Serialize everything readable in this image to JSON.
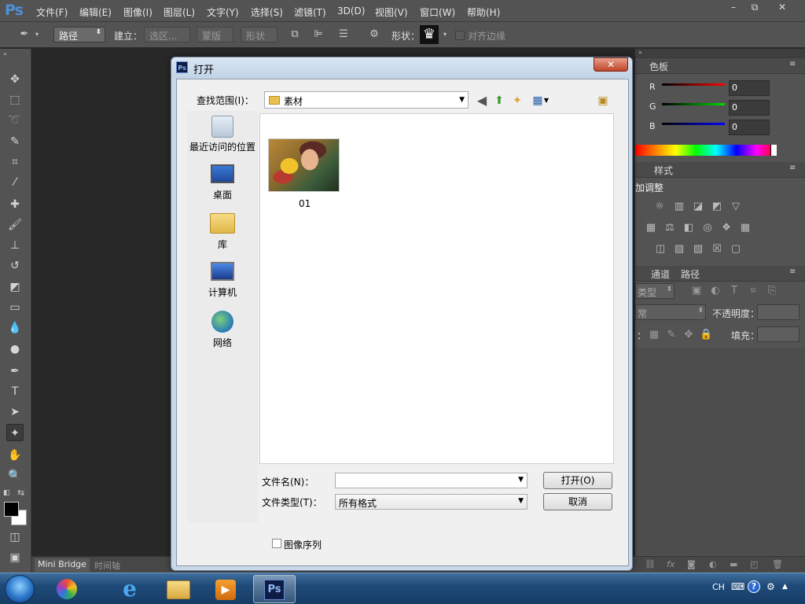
{
  "ps": {
    "logo": "Ps",
    "menus": [
      "文件(F)",
      "编辑(E)",
      "图像(I)",
      "图层(L)",
      "文字(Y)",
      "选择(S)",
      "滤镜(T)",
      "3D(D)",
      "视图(V)",
      "窗口(W)",
      "帮助(H)"
    ],
    "window_buttons": {
      "minimize": "–",
      "restore": "⧉",
      "close": "✕"
    }
  },
  "options_bar": {
    "mode_value": "路径",
    "make_label": "建立：",
    "selection_btn": "选区...",
    "mask_btn": "蒙版",
    "shape_btn": "形状",
    "shape_label": "形状：",
    "align_edges_label": "对齐边缘"
  },
  "right_panels": {
    "color_tab": "色板",
    "r_label": "R",
    "g_label": "G",
    "b_label": "B",
    "r_value": "0",
    "g_value": "0",
    "b_value": "0",
    "styles_tab": "样式",
    "adjust_title": "加调整",
    "layers_tabs": [
      "通道",
      "路径"
    ],
    "kind_label": "类型",
    "blend_label": "常",
    "opacity_label": "不透明度：",
    "lock_label": "：",
    "fill_label": "填充："
  },
  "bottom_bar": {
    "tabs": [
      "Mini Bridge",
      "时间轴"
    ]
  },
  "dialog": {
    "title": "打开",
    "close": "✕",
    "look_in_label": "查找范围(I)：",
    "look_in_value": "素材",
    "places": [
      {
        "label": "最近访问的位置",
        "icon": "recent-places-icon"
      },
      {
        "label": "桌面",
        "icon": "desktop-icon"
      },
      {
        "label": "库",
        "icon": "libraries-icon"
      },
      {
        "label": "计算机",
        "icon": "computer-icon"
      },
      {
        "label": "网络",
        "icon": "network-icon"
      }
    ],
    "files": [
      {
        "name": "01"
      }
    ],
    "filename_label": "文件名(N)：",
    "filename_value": "",
    "filetype_label": "文件类型(T)：",
    "filetype_value": "所有格式",
    "open_button": "打开(O)",
    "cancel_button": "取消",
    "image_sequence_label": "图像序列"
  },
  "taskbar": {
    "ime": "CH",
    "items": [
      "windows-start-orb",
      "picasa-icon",
      "internet-explorer-icon",
      "file-explorer-icon",
      "media-player-icon",
      "photoshop-icon"
    ]
  }
}
